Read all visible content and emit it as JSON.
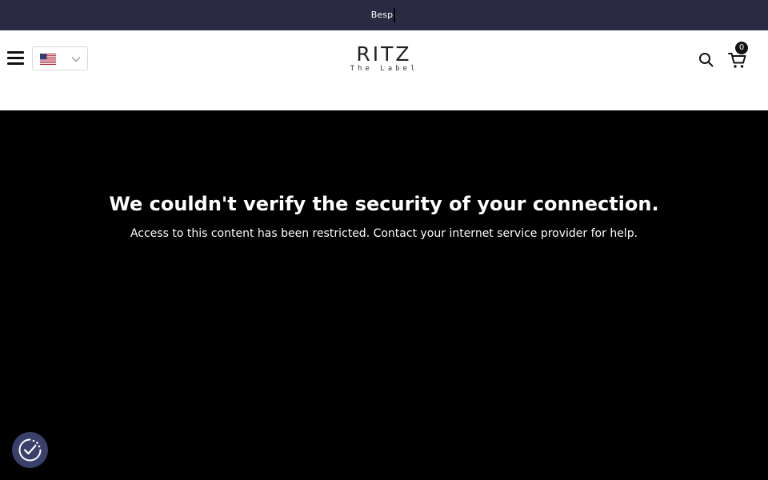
{
  "announcement": {
    "text": "Besp",
    "background": "#2a2b43"
  },
  "header": {
    "menu_icon": "hamburger-menu-icon",
    "country_selector": {
      "selected": "United States",
      "flag_icon": "us-flag-icon",
      "chevron_icon": "chevron-down-icon"
    },
    "logo": {
      "main": "RITZ",
      "sub": "The Label"
    },
    "search_icon": "search-icon",
    "cart": {
      "icon": "cart-icon",
      "count": "0"
    }
  },
  "error": {
    "title": "We couldn't verify the security of your connection.",
    "message": "Access to this content has been restricted. Contact your internet service provider for help."
  },
  "consent": {
    "icon": "cookie-consent-icon",
    "color": "#39416b"
  }
}
